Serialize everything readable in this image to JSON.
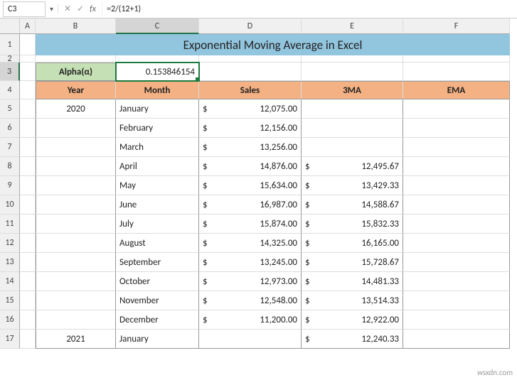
{
  "nameBox": "C3",
  "formula": "=2/(12+1)",
  "colHeads": [
    "A",
    "B",
    "C",
    "D",
    "E",
    "F"
  ],
  "rowHeads": [
    "1",
    "2",
    "3",
    "4",
    "5",
    "6",
    "7",
    "8",
    "9",
    "10",
    "11",
    "12",
    "13",
    "14",
    "15",
    "16",
    "17"
  ],
  "title": "Exponential Moving Average in Excel",
  "alpha": {
    "label": "Alpha(α)",
    "value": "0.153846154"
  },
  "headers": {
    "year": "Year",
    "month": "Month",
    "sales": "Sales",
    "ma3": "3MA",
    "ema": "EMA"
  },
  "rows": [
    {
      "year": "2020",
      "month": "January",
      "sales": "12,075.00",
      "ma3": "",
      "ema": ""
    },
    {
      "year": "",
      "month": "February",
      "sales": "12,156.00",
      "ma3": "",
      "ema": ""
    },
    {
      "year": "",
      "month": "March",
      "sales": "13,256.00",
      "ma3": "",
      "ema": ""
    },
    {
      "year": "",
      "month": "April",
      "sales": "14,876.00",
      "ma3": "12,495.67",
      "ema": ""
    },
    {
      "year": "",
      "month": "May",
      "sales": "15,634.00",
      "ma3": "13,429.33",
      "ema": ""
    },
    {
      "year": "",
      "month": "June",
      "sales": "16,987.00",
      "ma3": "14,588.67",
      "ema": ""
    },
    {
      "year": "",
      "month": "July",
      "sales": "15,874.00",
      "ma3": "15,832.33",
      "ema": ""
    },
    {
      "year": "",
      "month": "August",
      "sales": "14,325.00",
      "ma3": "16,165.00",
      "ema": ""
    },
    {
      "year": "",
      "month": "September",
      "sales": "13,245.00",
      "ma3": "15,728.67",
      "ema": ""
    },
    {
      "year": "",
      "month": "October",
      "sales": "12,973.00",
      "ma3": "14,481.33",
      "ema": ""
    },
    {
      "year": "",
      "month": "November",
      "sales": "12,548.00",
      "ma3": "13,514.33",
      "ema": ""
    },
    {
      "year": "",
      "month": "December",
      "sales": "11,200.00",
      "ma3": "12,922.00",
      "ema": ""
    },
    {
      "year": "2021",
      "month": "January",
      "sales": "",
      "ma3": "12,240.33",
      "ema": ""
    }
  ],
  "currency": "$",
  "watermark": "wsxdn.com",
  "chart_data": {
    "type": "table",
    "title": "Exponential Moving Average in Excel",
    "columns": [
      "Year",
      "Month",
      "Sales",
      "3MA",
      "EMA"
    ],
    "alpha": 0.153846154,
    "data": [
      {
        "Year": 2020,
        "Month": "January",
        "Sales": 12075.0,
        "3MA": null,
        "EMA": null
      },
      {
        "Year": 2020,
        "Month": "February",
        "Sales": 12156.0,
        "3MA": null,
        "EMA": null
      },
      {
        "Year": 2020,
        "Month": "March",
        "Sales": 13256.0,
        "3MA": null,
        "EMA": null
      },
      {
        "Year": 2020,
        "Month": "April",
        "Sales": 14876.0,
        "3MA": 12495.67,
        "EMA": null
      },
      {
        "Year": 2020,
        "Month": "May",
        "Sales": 15634.0,
        "3MA": 13429.33,
        "EMA": null
      },
      {
        "Year": 2020,
        "Month": "June",
        "Sales": 16987.0,
        "3MA": 14588.67,
        "EMA": null
      },
      {
        "Year": 2020,
        "Month": "July",
        "Sales": 15874.0,
        "3MA": 15832.33,
        "EMA": null
      },
      {
        "Year": 2020,
        "Month": "August",
        "Sales": 14325.0,
        "3MA": 16165.0,
        "EMA": null
      },
      {
        "Year": 2020,
        "Month": "September",
        "Sales": 13245.0,
        "3MA": 15728.67,
        "EMA": null
      },
      {
        "Year": 2020,
        "Month": "October",
        "Sales": 12973.0,
        "3MA": 14481.33,
        "EMA": null
      },
      {
        "Year": 2020,
        "Month": "November",
        "Sales": 12548.0,
        "3MA": 13514.33,
        "EMA": null
      },
      {
        "Year": 2020,
        "Month": "December",
        "Sales": 11200.0,
        "3MA": 12922.0,
        "EMA": null
      },
      {
        "Year": 2021,
        "Month": "January",
        "Sales": null,
        "3MA": 12240.33,
        "EMA": null
      }
    ]
  }
}
